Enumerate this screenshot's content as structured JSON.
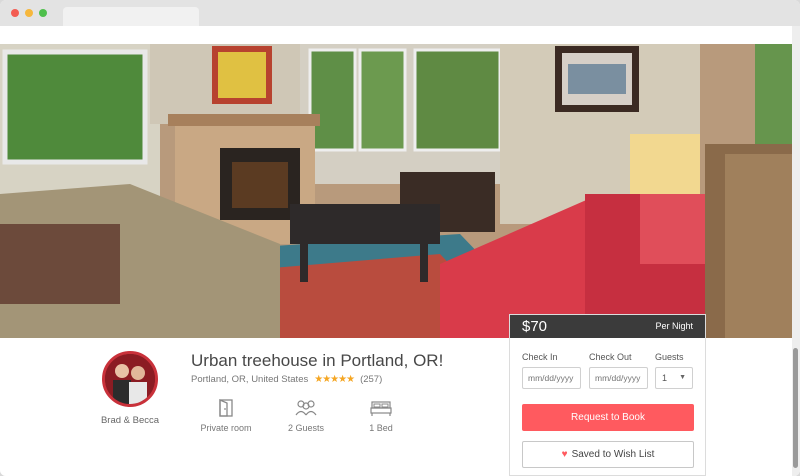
{
  "colors": {
    "accent": "#ff5a5f",
    "price_bar": "#3b3b3b",
    "star": "#f5a623"
  },
  "listing": {
    "title": "Urban treehouse in Portland, OR!",
    "location": "Portland, OR, United States",
    "rating_stars": "★★★★★",
    "rating_value": 5,
    "review_count": "(257)",
    "host_name": "Brad & Becca",
    "facts": [
      {
        "icon": "door-icon",
        "label": "Private room"
      },
      {
        "icon": "guests-icon",
        "label": "2 Guests"
      },
      {
        "icon": "bed-icon",
        "label": "1 Bed"
      }
    ]
  },
  "booking": {
    "price": "$70",
    "per": "Per Night",
    "check_in_label": "Check In",
    "check_out_label": "Check Out",
    "guests_label": "Guests",
    "check_in_placeholder": "mm/dd/yyyy",
    "check_out_placeholder": "mm/dd/yyyy",
    "guests_value": "1",
    "book_label": "Request to Book",
    "wish_label": "Saved to Wish List"
  }
}
